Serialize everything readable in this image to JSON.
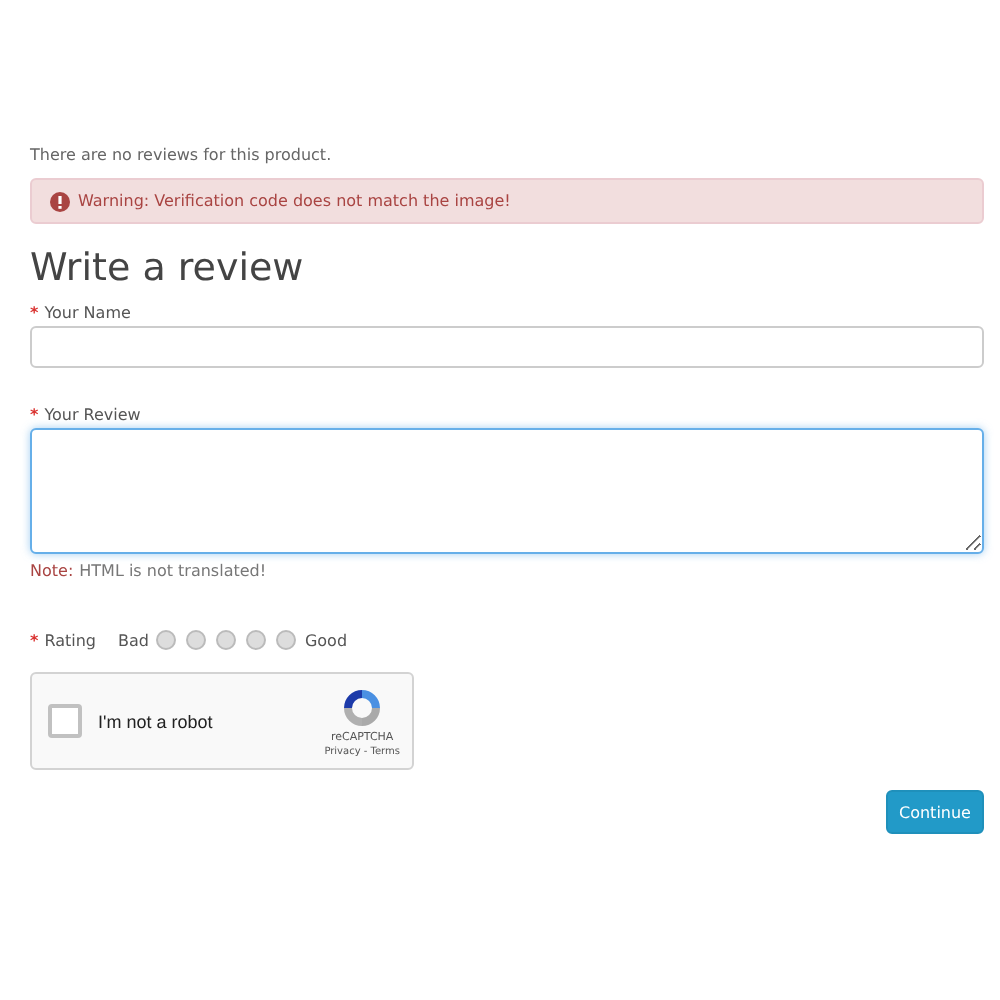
{
  "no_reviews_text": "There are no reviews for this product.",
  "alert": {
    "text": "Warning: Verification code does not match the image!"
  },
  "heading": "Write a review",
  "fields": [
    {
      "kind": "input",
      "required_mark": "*",
      "label": "Your Name",
      "focused": false
    },
    {
      "kind": "textarea",
      "required_mark": "*",
      "label": "Your Review",
      "focused": true
    }
  ],
  "note": {
    "label": "Note:",
    "text": "HTML is not translated!"
  },
  "rating": {
    "required_mark": "*",
    "label": "Rating",
    "low": "Bad",
    "high": "Good",
    "options": [
      {
        "selected": false
      },
      {
        "selected": false
      },
      {
        "selected": false
      },
      {
        "selected": false
      },
      {
        "selected": false
      }
    ]
  },
  "captcha": {
    "label": "I'm not a robot",
    "checked": false,
    "brand": "reCAPTCHA",
    "links": "Privacy - Terms"
  },
  "buttons": [
    "Continue"
  ]
}
